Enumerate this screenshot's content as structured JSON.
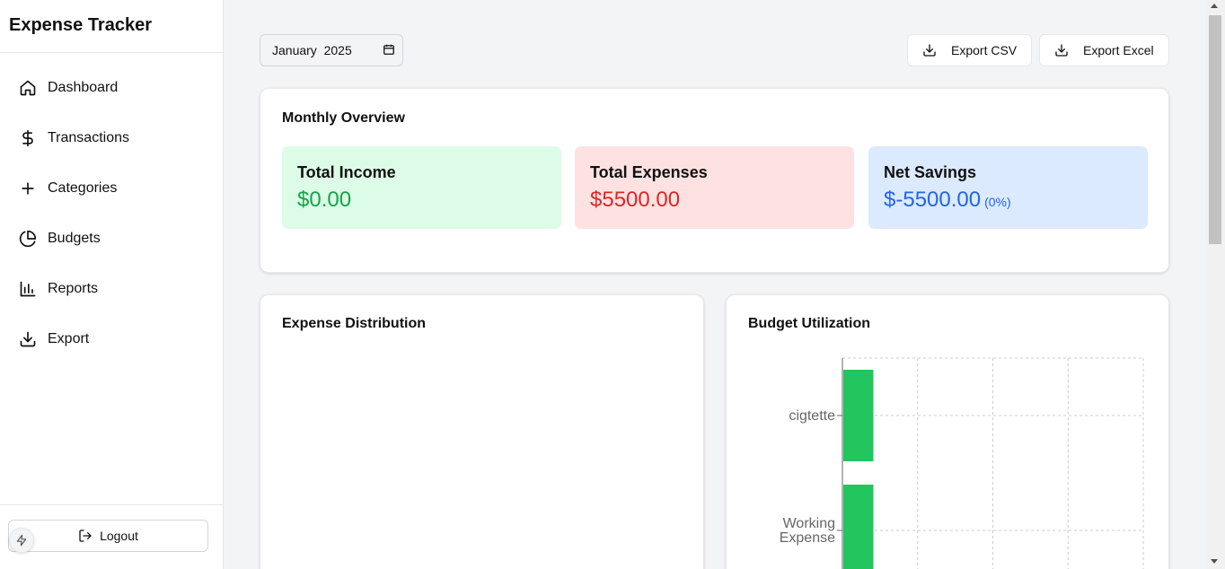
{
  "app": {
    "title": "Expense Tracker"
  },
  "sidebar": {
    "items": [
      {
        "label": "Dashboard",
        "icon": "home-icon"
      },
      {
        "label": "Transactions",
        "icon": "dollar-icon"
      },
      {
        "label": "Categories",
        "icon": "plus-icon"
      },
      {
        "label": "Budgets",
        "icon": "pie-chart-icon"
      },
      {
        "label": "Reports",
        "icon": "bar-chart-icon"
      },
      {
        "label": "Export",
        "icon": "download-icon"
      }
    ],
    "logout_label": "Logout"
  },
  "toolbar": {
    "month_value": "January  2025",
    "export_csv_label": "Export CSV",
    "export_excel_label": "Export Excel"
  },
  "overview": {
    "title": "Monthly Overview",
    "income": {
      "label": "Total Income",
      "value": "$0.00"
    },
    "expenses": {
      "label": "Total Expenses",
      "value": "$5500.00"
    },
    "savings": {
      "label": "Net Savings",
      "value": "$-5500.00",
      "percent": "(0%)"
    }
  },
  "expense_distribution": {
    "title": "Expense Distribution"
  },
  "budget_utilization": {
    "title": "Budget Utilization"
  },
  "colors": {
    "income": "#16a34a",
    "expenses": "#dc2626",
    "savings": "#2563eb",
    "bar": "#22c55e"
  },
  "chart_data": {
    "type": "bar",
    "orientation": "horizontal",
    "categories": [
      "cigtette",
      "Working Expense"
    ],
    "series": [
      {
        "values": [
          10,
          10
        ]
      }
    ],
    "xlim": [
      0,
      100
    ],
    "grid": true
  }
}
